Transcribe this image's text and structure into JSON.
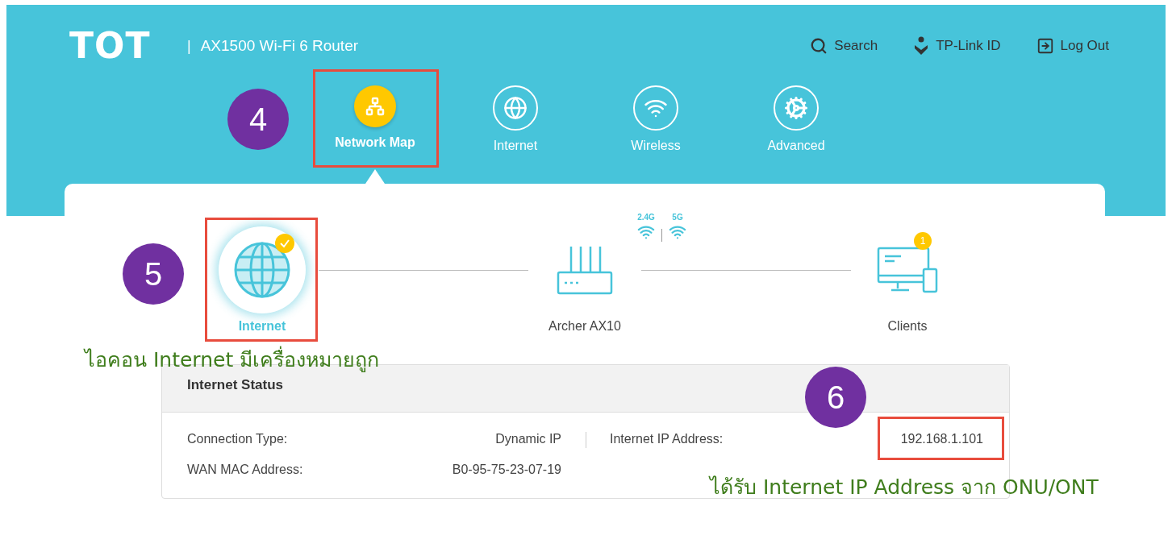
{
  "header": {
    "logo": "TOT",
    "separator": "|",
    "product": "AX1500 Wi-Fi 6 Router",
    "links": [
      {
        "label": "Search",
        "kind": "search"
      },
      {
        "label": "TP-Link ID",
        "kind": "account"
      },
      {
        "label": "Log Out",
        "kind": "logout"
      }
    ]
  },
  "tabs": [
    {
      "label": "Network Map",
      "kind": "map",
      "selected": true
    },
    {
      "label": "Internet",
      "kind": "globe",
      "selected": false
    },
    {
      "label": "Wireless",
      "kind": "wifi",
      "selected": false
    },
    {
      "label": "Advanced",
      "kind": "gear",
      "selected": false
    }
  ],
  "network_map": {
    "internet": {
      "label": "Internet",
      "connected": true,
      "selected": true
    },
    "router": {
      "label": "Archer AX10",
      "bands": [
        "2.4G",
        "5G"
      ]
    },
    "clients": {
      "label": "Clients",
      "badge": "1"
    }
  },
  "internet_status": {
    "title": "Internet Status",
    "fields": [
      {
        "label": "Connection Type:",
        "value": "Dynamic IP"
      },
      {
        "label": "Internet IP Address:",
        "value": "192.168.1.101"
      },
      {
        "label": "WAN MAC Address:",
        "value": "B0-95-75-23-07-19"
      }
    ]
  },
  "annotations": [
    {
      "marker": "4"
    },
    {
      "marker": "5",
      "caption": "ไอคอน Internet มีเครื่องหมายถูก"
    },
    {
      "marker": "6",
      "caption": "ได้รับ Internet IP Address จาก ONU/ONT"
    }
  ]
}
